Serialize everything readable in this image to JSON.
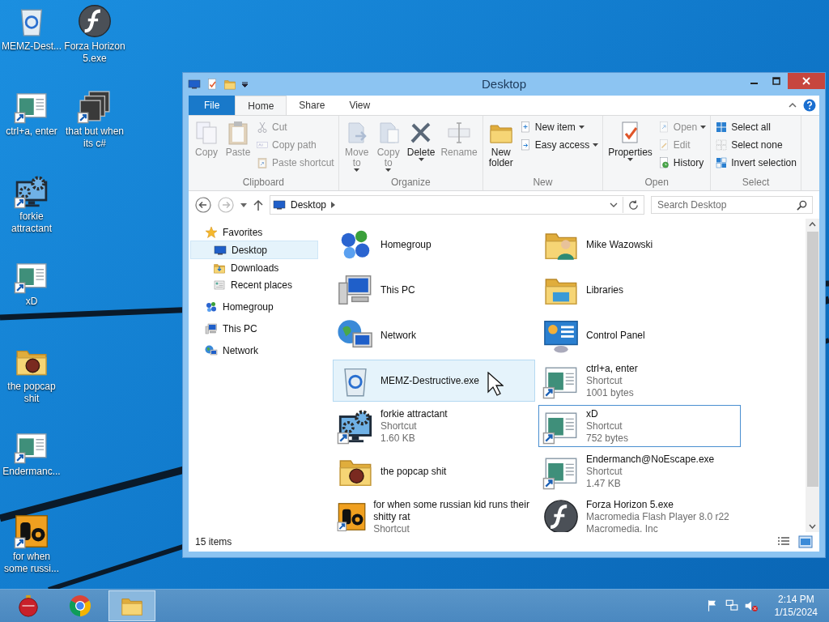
{
  "desktop": {
    "icons": [
      {
        "label": "MEMZ-Dest...",
        "kind": "bin",
        "shortcut": false
      },
      {
        "label": "ctrl+a, enter",
        "kind": "app",
        "shortcut": true
      },
      {
        "label": "forkie attractant",
        "kind": "gearmon",
        "shortcut": true
      },
      {
        "label": "xD",
        "kind": "app",
        "shortcut": true
      },
      {
        "label": "the popcap shit",
        "kind": "popfolder",
        "shortcut": false
      },
      {
        "label": "Endermanc...",
        "kind": "app",
        "shortcut": true
      },
      {
        "label": "for when some russi...",
        "kind": "de",
        "shortcut": true
      },
      {
        "label": "Forza Horizon 5.exe",
        "kind": "flash",
        "shortcut": false
      },
      {
        "label": "that but when its c#",
        "kind": "stack",
        "shortcut": true
      }
    ]
  },
  "window": {
    "title": "Desktop",
    "tabs": [
      {
        "label": "File",
        "kind": "menu",
        "selected": false
      },
      {
        "label": "Home",
        "kind": "tab",
        "selected": true
      },
      {
        "label": "Share",
        "kind": "tab",
        "selected": false
      },
      {
        "label": "View",
        "kind": "tab",
        "selected": false
      }
    ],
    "ribbon": [
      {
        "name": "Clipboard",
        "large_buttons": [
          {
            "label_lines": [
              "Copy"
            ],
            "kind": "copy",
            "disabled": true,
            "dropdown": false
          },
          {
            "label_lines": [
              "Paste"
            ],
            "kind": "paste",
            "disabled": true,
            "dropdown": false
          }
        ],
        "small_buttons": [
          {
            "label": "Cut",
            "kind": "cut",
            "disabled": true,
            "dropdown": false
          },
          {
            "label": "Copy path",
            "kind": "copypath",
            "disabled": true,
            "dropdown": false
          },
          {
            "label": "Paste shortcut",
            "kind": "pasteshortcut",
            "disabled": true,
            "dropdown": false
          }
        ]
      },
      {
        "name": "Organize",
        "large_buttons": [
          {
            "label_lines": [
              "Move",
              "to"
            ],
            "kind": "moveto",
            "disabled": true,
            "dropdown": true
          },
          {
            "label_lines": [
              "Copy",
              "to"
            ],
            "kind": "copyto",
            "disabled": true,
            "dropdown": true
          },
          {
            "label_lines": [
              "Delete"
            ],
            "kind": "delete",
            "disabled": false,
            "dropdown": true
          },
          {
            "label_lines": [
              "Rename"
            ],
            "kind": "rename",
            "disabled": true,
            "dropdown": false
          }
        ]
      },
      {
        "name": "New",
        "large_buttons": [
          {
            "label_lines": [
              "New",
              "folder"
            ],
            "kind": "newfolder",
            "disabled": false,
            "dropdown": false
          }
        ],
        "small_buttons": [
          {
            "label": "New item",
            "kind": "newitem",
            "disabled": false,
            "dropdown": true
          },
          {
            "label": "Easy access",
            "kind": "easyaccess",
            "disabled": false,
            "dropdown": true
          }
        ]
      },
      {
        "name": "Open",
        "large_buttons": [
          {
            "label_lines": [
              "Properties"
            ],
            "kind": "properties",
            "disabled": false,
            "dropdown": true
          }
        ],
        "small_buttons": [
          {
            "label": "Open",
            "kind": "open",
            "disabled": true,
            "dropdown": true
          },
          {
            "label": "Edit",
            "kind": "edit",
            "disabled": true,
            "dropdown": false
          },
          {
            "label": "History",
            "kind": "history",
            "disabled": false,
            "dropdown": false
          }
        ]
      },
      {
        "name": "Select",
        "small_buttons": [
          {
            "label": "Select all",
            "kind": "selectall",
            "disabled": false,
            "dropdown": false
          },
          {
            "label": "Select none",
            "kind": "selectnone",
            "disabled": false,
            "dropdown": false
          },
          {
            "label": "Invert selection",
            "kind": "invert",
            "disabled": false,
            "dropdown": false
          }
        ]
      }
    ],
    "address": {
      "path": "Desktop",
      "search_placeholder": "Search Desktop"
    },
    "nav": [
      {
        "label": "Favorites",
        "kind": "star",
        "selected": false,
        "children": [
          {
            "label": "Desktop",
            "kind": "desktop",
            "selected": true
          },
          {
            "label": "Downloads",
            "kind": "downloads",
            "selected": false
          },
          {
            "label": "Recent places",
            "kind": "recent",
            "selected": false
          }
        ]
      },
      {
        "label": "Homegroup",
        "kind": "homegroup",
        "selected": false
      },
      {
        "label": "This PC",
        "kind": "pc",
        "selected": false
      },
      {
        "label": "Network",
        "kind": "network",
        "selected": false
      }
    ],
    "files": [
      {
        "name": "Homegroup",
        "kind": "homegroup",
        "shortcut": false,
        "selected": false,
        "focused": false
      },
      {
        "name": "Mike Wazowski",
        "kind": "personfolder",
        "shortcut": false,
        "selected": false,
        "focused": false
      },
      {
        "name": "This PC",
        "kind": "pc",
        "shortcut": false,
        "selected": false,
        "focused": false
      },
      {
        "name": "Libraries",
        "kind": "library",
        "shortcut": false,
        "selected": false,
        "focused": false
      },
      {
        "name": "Network",
        "kind": "network",
        "shortcut": false,
        "selected": false,
        "focused": false
      },
      {
        "name": "Control Panel",
        "kind": "controlpanel",
        "shortcut": false,
        "selected": false,
        "focused": false
      },
      {
        "name": "MEMZ-Destructive.exe",
        "kind": "bin",
        "shortcut": false,
        "selected": true,
        "focused": false
      },
      {
        "name": "ctrl+a, enter",
        "kind": "app",
        "shortcut": true,
        "selected": false,
        "focused": false,
        "details": [
          "Shortcut",
          "1001 bytes"
        ]
      },
      {
        "name": "forkie attractant",
        "kind": "gearmon",
        "shortcut": true,
        "selected": false,
        "focused": false,
        "details": [
          "Shortcut",
          "1.60 KB"
        ]
      },
      {
        "name": "xD",
        "kind": "app",
        "shortcut": true,
        "selected": false,
        "focused": true,
        "details": [
          "Shortcut",
          "752 bytes"
        ]
      },
      {
        "name": "the popcap shit",
        "kind": "popfolder",
        "shortcut": false,
        "selected": false,
        "focused": false
      },
      {
        "name": "Endermanch@NoEscape.exe",
        "kind": "app",
        "shortcut": true,
        "selected": false,
        "focused": false,
        "details": [
          "Shortcut",
          "1.47 KB"
        ]
      },
      {
        "name": "for when some russian kid runs their shitty rat",
        "kind": "de",
        "shortcut": true,
        "selected": false,
        "focused": false,
        "details": [
          "Shortcut"
        ]
      },
      {
        "name": "Forza Horizon 5.exe",
        "kind": "flash",
        "shortcut": false,
        "selected": false,
        "focused": false,
        "details": [
          "Macromedia Flash Player 8.0  r22",
          "Macromedia, Inc"
        ]
      }
    ],
    "status": "15 items"
  },
  "taskbar": {
    "apps": [
      {
        "kind": "ornament",
        "selected": false
      },
      {
        "kind": "chrome",
        "selected": false
      },
      {
        "kind": "explorer",
        "selected": true
      }
    ],
    "tray": [
      {
        "kind": "flag"
      },
      {
        "kind": "traynet"
      },
      {
        "kind": "mute"
      }
    ],
    "time": "2:14 PM",
    "date": "1/15/2024"
  }
}
